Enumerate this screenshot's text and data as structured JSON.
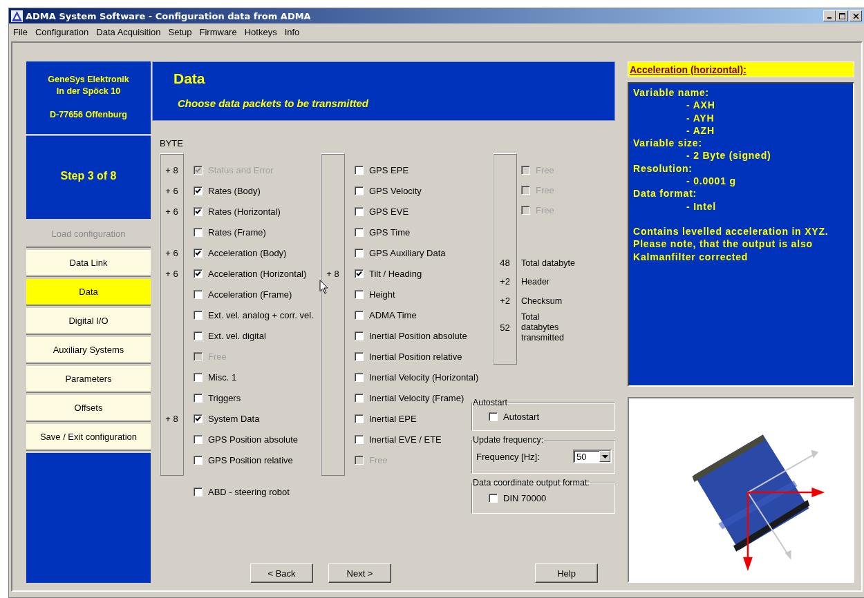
{
  "window": {
    "title": "ADMA System Software - Configuration data from ADMA"
  },
  "menu": [
    "File",
    "Configuration",
    "Data Acquisition",
    "Setup",
    "Firmware",
    "Hotkeys",
    "Info"
  ],
  "sidebar": {
    "company": [
      "GeneSys Elektronik",
      "In der Spöck 10",
      "D-77656 Offenburg"
    ],
    "step": "Step 3 of 8",
    "items": [
      {
        "label": "Load configuration",
        "selected": false,
        "disabled": true
      },
      {
        "label": "Data Link",
        "selected": false,
        "disabled": false
      },
      {
        "label": "Data",
        "selected": true,
        "disabled": false
      },
      {
        "label": "Digital I/O",
        "selected": false,
        "disabled": false
      },
      {
        "label": "Auxiliary Systems",
        "selected": false,
        "disabled": false
      },
      {
        "label": "Parameters",
        "selected": false,
        "disabled": false
      },
      {
        "label": "Offsets",
        "selected": false,
        "disabled": false
      },
      {
        "label": "Save / Exit configuration",
        "selected": false,
        "disabled": false
      }
    ]
  },
  "header": {
    "title": "Data",
    "subtitle": "Choose data packets to be transmitted"
  },
  "byte_label": "BYTE",
  "columns": [
    {
      "rows": [
        {
          "byte": "+ 8",
          "label": "Status and Error",
          "checked": true,
          "disabled": true
        },
        {
          "byte": "+ 6",
          "label": "Rates (Body)",
          "checked": true,
          "disabled": false
        },
        {
          "byte": "+ 6",
          "label": "Rates (Horizontal)",
          "checked": true,
          "disabled": false
        },
        {
          "label": "Rates (Frame)",
          "checked": false,
          "disabled": false
        },
        {
          "byte": "+ 6",
          "label": "Acceleration (Body)",
          "checked": true,
          "disabled": false
        },
        {
          "byte": "+ 6",
          "label": "Acceleration (Horizontal)",
          "checked": true,
          "disabled": false
        },
        {
          "label": "Acceleration (Frame)",
          "checked": false,
          "disabled": false
        },
        {
          "label": "Ext. vel. analog + corr. vel.",
          "checked": false,
          "disabled": false
        },
        {
          "label": "Ext. vel. digital",
          "checked": false,
          "disabled": false
        },
        {
          "label": "Free",
          "checked": false,
          "disabled": true
        },
        {
          "label": "Misc. 1",
          "checked": false,
          "disabled": false
        },
        {
          "label": "Triggers",
          "checked": false,
          "disabled": false
        },
        {
          "byte": "+ 8",
          "label": "System Data",
          "checked": true,
          "disabled": false
        },
        {
          "label": "GPS Position absolute",
          "checked": false,
          "disabled": false
        },
        {
          "label": "GPS Position relative",
          "checked": false,
          "disabled": false
        }
      ]
    },
    {
      "rows": [
        {
          "label": "GPS EPE",
          "checked": false,
          "disabled": false
        },
        {
          "label": "GPS Velocity",
          "checked": false,
          "disabled": false
        },
        {
          "label": "GPS EVE",
          "checked": false,
          "disabled": false
        },
        {
          "label": "GPS Time",
          "checked": false,
          "disabled": false
        },
        {
          "label": "GPS Auxiliary Data",
          "checked": false,
          "disabled": false
        },
        {
          "byte": "+ 8",
          "label": "Tilt / Heading",
          "checked": true,
          "disabled": false
        },
        {
          "label": "Height",
          "checked": false,
          "disabled": false
        },
        {
          "label": "ADMA Time",
          "checked": false,
          "disabled": false
        },
        {
          "label": "Inertial Position absolute",
          "checked": false,
          "disabled": false
        },
        {
          "label": "Inertial Position relative",
          "checked": false,
          "disabled": false
        },
        {
          "label": "Inertial Velocity (Horizontal)",
          "checked": false,
          "disabled": false
        },
        {
          "label": "Inertial Velocity (Frame)",
          "checked": false,
          "disabled": false
        },
        {
          "label": "Inertial EPE",
          "checked": false,
          "disabled": false
        },
        {
          "label": "Inertial EVE / ETE",
          "checked": false,
          "disabled": false
        },
        {
          "label": "Free",
          "checked": false,
          "disabled": true
        }
      ]
    },
    {
      "rows": [
        {
          "label": "Free",
          "checked": false,
          "disabled": true
        },
        {
          "label": "Free",
          "checked": false,
          "disabled": true
        },
        {
          "label": "Free",
          "checked": false,
          "disabled": true
        }
      ]
    }
  ],
  "totals": [
    {
      "value": "48",
      "label": "Total databyte"
    },
    {
      "value": "+2",
      "label": "Header"
    },
    {
      "value": "+2",
      "label": "Checksum"
    },
    {
      "value": "52",
      "label": "Total databytes transmitted"
    }
  ],
  "abd": {
    "label": "ABD - steering robot",
    "checked": false
  },
  "autostart": {
    "legend": "Autostart",
    "label": "Autostart",
    "checked": false
  },
  "update": {
    "legend": "Update frequency:",
    "label": "Frequency [Hz]:",
    "value": "50"
  },
  "coord": {
    "legend": "Data coordinate output format:",
    "label": "DIN 70000",
    "checked": false
  },
  "buttons": {
    "back": "< Back",
    "next": "Next >",
    "help": "Help"
  },
  "info": {
    "title": "Acceleration (horizontal):",
    "lines": [
      {
        "kind": "label",
        "text": "Variable name:"
      },
      {
        "kind": "value",
        "text": "- AXH"
      },
      {
        "kind": "value",
        "text": "- AYH"
      },
      {
        "kind": "value",
        "text": "- AZH"
      },
      {
        "kind": "label",
        "text": "Variable size:"
      },
      {
        "kind": "value",
        "text": "- 2 Byte (signed)"
      },
      {
        "kind": "label",
        "text": "Resolution:"
      },
      {
        "kind": "value",
        "text": "- 0.0001 g"
      },
      {
        "kind": "label",
        "text": "Data format:"
      },
      {
        "kind": "value",
        "text": "- Intel"
      },
      {
        "kind": "note",
        "text": "Contains levelled acceleration in XYZ. Please note, that the output is also Kalmanfilter corrected"
      }
    ]
  }
}
